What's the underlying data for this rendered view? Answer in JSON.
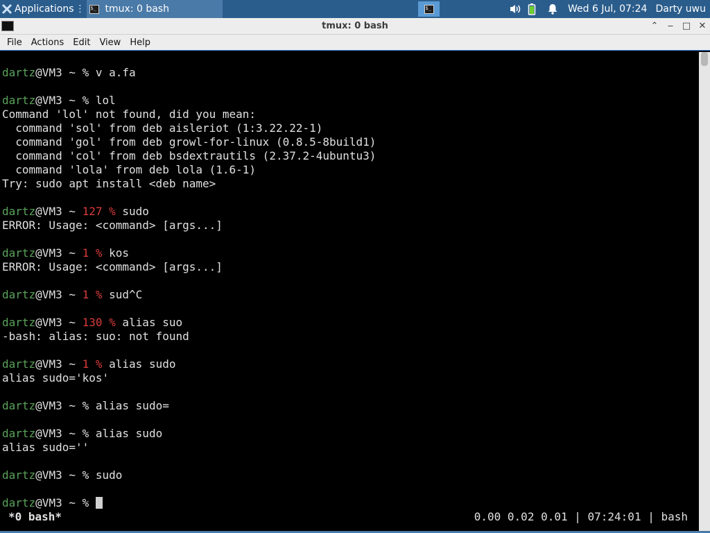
{
  "panel": {
    "applications_label": "Applications",
    "task_title": "tmux: 0 bash",
    "clock": "Wed  6 Jul, 07:24",
    "user": "Darty uwu"
  },
  "window": {
    "title": "tmux: 0 bash",
    "controls": {
      "shade": "⌃",
      "minimize": "‒",
      "maximize": "□",
      "close": "✕"
    }
  },
  "menu": {
    "file": "File",
    "actions": "Actions",
    "edit": "Edit",
    "view": "View",
    "help": "Help"
  },
  "terminal": {
    "lines": [
      {
        "user": "dartz",
        "host": "@VM3 ~ ",
        "code": "",
        "prompt": "% ",
        "cmd": "v a.fa"
      },
      {
        "text": ""
      },
      {
        "user": "dartz",
        "host": "@VM3 ~ ",
        "code": "",
        "prompt": "% ",
        "cmd": "lol"
      },
      {
        "text": "Command 'lol' not found, did you mean:"
      },
      {
        "text": "  command 'sol' from deb aisleriot (1:3.22.22-1)"
      },
      {
        "text": "  command 'gol' from deb growl-for-linux (0.8.5-8build1)"
      },
      {
        "text": "  command 'col' from deb bsdextrautils (2.37.2-4ubuntu3)"
      },
      {
        "text": "  command 'lola' from deb lola (1.6-1)"
      },
      {
        "text": "Try: sudo apt install <deb name>"
      },
      {
        "text": ""
      },
      {
        "user": "dartz",
        "host": "@VM3 ~ ",
        "code": "127 ",
        "prompt": "% ",
        "cmd": "sudo"
      },
      {
        "text": "ERROR: Usage: <command> [args...]"
      },
      {
        "text": ""
      },
      {
        "user": "dartz",
        "host": "@VM3 ~ ",
        "code": "1 ",
        "prompt": "% ",
        "cmd": "kos"
      },
      {
        "text": "ERROR: Usage: <command> [args...]"
      },
      {
        "text": ""
      },
      {
        "user": "dartz",
        "host": "@VM3 ~ ",
        "code": "1 ",
        "prompt": "% ",
        "cmd": "sud^C"
      },
      {
        "text": ""
      },
      {
        "user": "dartz",
        "host": "@VM3 ~ ",
        "code": "130 ",
        "prompt": "% ",
        "cmd": "alias suo"
      },
      {
        "text": "-bash: alias: suo: not found"
      },
      {
        "text": ""
      },
      {
        "user": "dartz",
        "host": "@VM3 ~ ",
        "code": "1 ",
        "prompt": "% ",
        "cmd": "alias sudo"
      },
      {
        "text": "alias sudo='kos'"
      },
      {
        "text": ""
      },
      {
        "user": "dartz",
        "host": "@VM3 ~ ",
        "code": "",
        "prompt": "% ",
        "cmd": "alias sudo="
      },
      {
        "text": ""
      },
      {
        "user": "dartz",
        "host": "@VM3 ~ ",
        "code": "",
        "prompt": "% ",
        "cmd": "alias sudo"
      },
      {
        "text": "alias sudo=''"
      },
      {
        "text": ""
      },
      {
        "user": "dartz",
        "host": "@VM3 ~ ",
        "code": "",
        "prompt": "% ",
        "cmd": "sudo"
      },
      {
        "text": ""
      },
      {
        "user": "dartz",
        "host": "@VM3 ~ ",
        "code": "",
        "prompt": "% ",
        "cmd": "",
        "cursor": true
      }
    ]
  },
  "tmux_status": {
    "window": "*0 bash*",
    "right": "0.00 0.02 0.01 | 07:24:01 | bash"
  },
  "colors": {
    "panel": "#2b5d8c",
    "user": "#5aa35a",
    "error_code": "#d83c3c",
    "terminal_bg": "#000000",
    "terminal_fg": "#e0e0e0"
  }
}
